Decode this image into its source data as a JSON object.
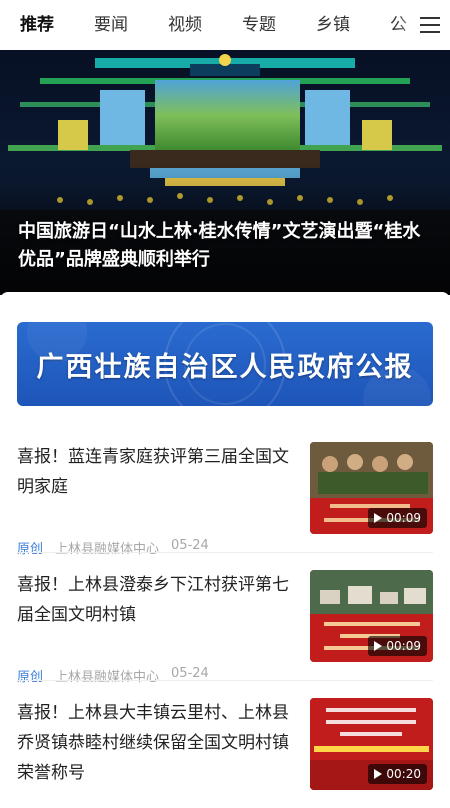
{
  "nav": {
    "tabs": [
      {
        "label": "推荐",
        "active": true
      },
      {
        "label": "要闻",
        "active": false
      },
      {
        "label": "视频",
        "active": false
      },
      {
        "label": "专题",
        "active": false
      },
      {
        "label": "乡镇",
        "active": false
      },
      {
        "label": "公",
        "active": false
      }
    ],
    "menu_icon": "menu-icon"
  },
  "hero": {
    "caption": "中国旅游日“山水上林·桂水传情”文艺演出暨“桂水优品”品牌盛典顺利举行",
    "slide_count": 5,
    "active_slide": 3
  },
  "gazette": {
    "label": "广西壮族自治区人民政府公报"
  },
  "news": [
    {
      "title": "喜报！蓝连青家庭获评第三届全国文明家庭",
      "tag": "原创",
      "source": "上林县融媒体中心",
      "date": "05-24",
      "duration": "00:09"
    },
    {
      "title": "喜报！上林县澄泰乡下江村获评第七届全国文明村镇",
      "tag": "原创",
      "source": "上林县融媒体中心",
      "date": "05-24",
      "duration": "00:09"
    },
    {
      "title": "喜报！上林县大丰镇云里村、上林县乔贤镇恭睦村继续保留全国文明村镇荣誉称号",
      "duration": "00:20"
    }
  ],
  "colors": {
    "accent_blue": "#3f7fd9",
    "gazette_blue": "#1e55b8",
    "thumb_red": "#b91c1c"
  }
}
